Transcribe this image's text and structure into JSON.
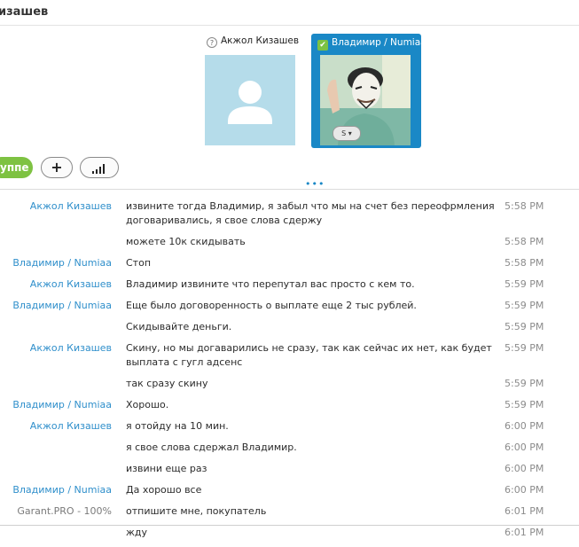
{
  "header": {
    "title": "изашев"
  },
  "participants": [
    {
      "name": "Акжол Кизашев"
    },
    {
      "name": "Владимир / Numiaa"
    }
  ],
  "toolbar": {
    "call_label": "уппе"
  },
  "messages": [
    {
      "sender": "Акжол Кизашев",
      "text": "извините тогда Владимир, я забыл что мы на счет без переофрмления договаривались, я свое слова сдержу",
      "time": "5:58 PM"
    },
    {
      "sender": "",
      "text": "можете 10к скидывать",
      "time": "5:58 PM"
    },
    {
      "sender": "Владимир / Numiaa",
      "text": "Стоп",
      "time": "5:58 PM"
    },
    {
      "sender": "Акжол Кизашев",
      "text": "Владимир извините что  перепутал вас просто с кем то.",
      "time": "5:59 PM"
    },
    {
      "sender": "Владимир / Numiaa",
      "text": "Еще было договоренность о выплате еще 2 тыс рублей.",
      "time": "5:59 PM"
    },
    {
      "sender": "",
      "text": "Скидывайте деньги.",
      "time": "5:59 PM"
    },
    {
      "sender": "Акжол Кизашев",
      "text": "Скину, но мы догаварились не сразу, так как сейчас их нет, как будет выплата с гугл адсенс",
      "time": "5:59 PM"
    },
    {
      "sender": "",
      "text": "так сразу скину",
      "time": "5:59 PM"
    },
    {
      "sender": "Владимир / Numiaa",
      "text": "Хорошо.",
      "time": "5:59 PM"
    },
    {
      "sender": "Акжол Кизашев",
      "text": "я отойду на 10 мин.",
      "time": "6:00 PM"
    },
    {
      "sender": "",
      "text": "я свое слова сдержал Владимир.",
      "time": "6:00 PM"
    },
    {
      "sender": "",
      "text": "извини еще раз",
      "time": "6:00 PM"
    },
    {
      "sender": "Владимир / Numiaa",
      "text": "Да хорошо все",
      "time": "6:00 PM"
    },
    {
      "sender": "Garant.PRO - 100%",
      "text": "отпишите мне, покупатель",
      "time": "6:01 PM"
    },
    {
      "sender": "",
      "text": "жду",
      "time": "6:01 PM"
    }
  ],
  "colors": {
    "accent": "#1a88c6",
    "link": "#2f8fcb",
    "call_green": "#7ec242"
  },
  "icons": [
    "question-icon",
    "check-icon",
    "user-placeholder-icon",
    "plus-icon",
    "signal-icon",
    "skype-icon"
  ]
}
